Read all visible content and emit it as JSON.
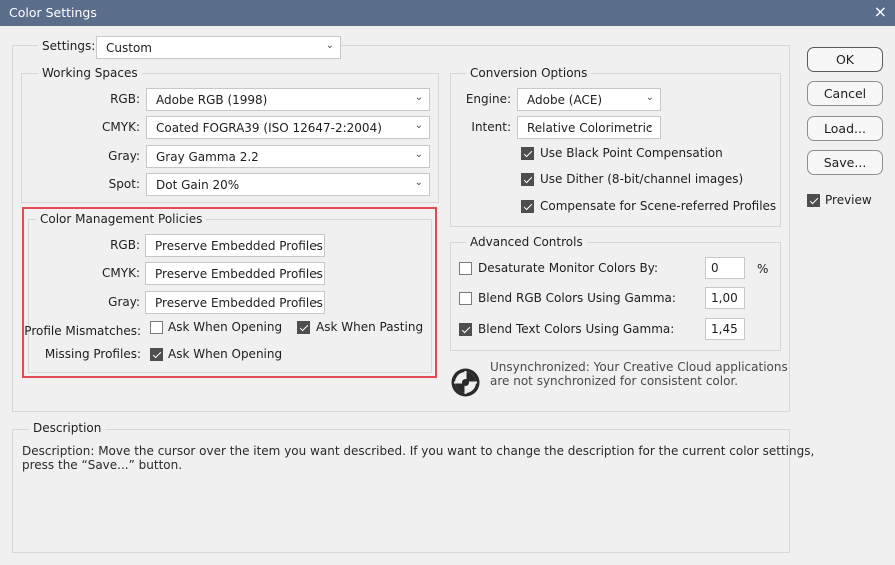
{
  "window": {
    "title": "Color Settings",
    "close_icon": "×"
  },
  "settings": {
    "label": "Settings:",
    "value": "Custom"
  },
  "working_spaces": {
    "title": "Working Spaces",
    "rgb": {
      "label": "RGB:",
      "value": "Adobe RGB (1998)"
    },
    "cmyk": {
      "label": "CMYK:",
      "value": "Coated FOGRA39 (ISO 12647-2:2004)"
    },
    "gray": {
      "label": "Gray:",
      "value": "Gray Gamma 2.2"
    },
    "spot": {
      "label": "Spot:",
      "value": "Dot Gain 20%"
    }
  },
  "policies": {
    "title": "Color Management Policies",
    "rgb": {
      "label": "RGB:",
      "value": "Preserve Embedded Profiles"
    },
    "cmyk": {
      "label": "CMYK:",
      "value": "Preserve Embedded Profiles"
    },
    "gray": {
      "label": "Gray:",
      "value": "Preserve Embedded Profiles"
    },
    "mismatch_label": "Profile Mismatches:",
    "mismatch_open": {
      "label": "Ask When Opening",
      "checked": false
    },
    "mismatch_paste": {
      "label": "Ask When Pasting",
      "checked": true
    },
    "missing_label": "Missing Profiles:",
    "missing_open": {
      "label": "Ask When Opening",
      "checked": true
    }
  },
  "conversion": {
    "title": "Conversion Options",
    "engine": {
      "label": "Engine:",
      "value": "Adobe (ACE)"
    },
    "intent": {
      "label": "Intent:",
      "value": "Relative Colorimetric"
    },
    "black_point": {
      "label": "Use Black Point Compensation",
      "checked": true
    },
    "dither": {
      "label": "Use Dither (8-bit/channel images)",
      "checked": true
    },
    "scene": {
      "label": "Compensate for Scene-referred Profiles",
      "checked": true
    }
  },
  "advanced": {
    "title": "Advanced Controls",
    "desaturate": {
      "label": "Desaturate Monitor Colors By:",
      "value": "0",
      "unit": "%",
      "checked": false
    },
    "blend_rgb": {
      "label": "Blend RGB Colors Using Gamma:",
      "value": "1,00",
      "checked": false
    },
    "blend_text": {
      "label": "Blend Text Colors Using Gamma:",
      "value": "1,45",
      "checked": true
    }
  },
  "sync": {
    "icon": "sync-status-icon",
    "line1": "Unsynchronized: Your Creative Cloud applications",
    "line2": "are not synchronized for consistent color."
  },
  "buttons": {
    "ok": "OK",
    "cancel": "Cancel",
    "load": "Load...",
    "save": "Save..."
  },
  "preview": {
    "label": "Preview",
    "checked": true
  },
  "description": {
    "title": "Description",
    "line1": "Description:  Move the cursor over the item you want described.  If you want to change the description for the current color settings,",
    "line2": "press the “Save...” button."
  },
  "colors": {
    "titlebar": "#5a6e8c",
    "highlight": "#e34a53",
    "background": "#f0f0f0"
  }
}
